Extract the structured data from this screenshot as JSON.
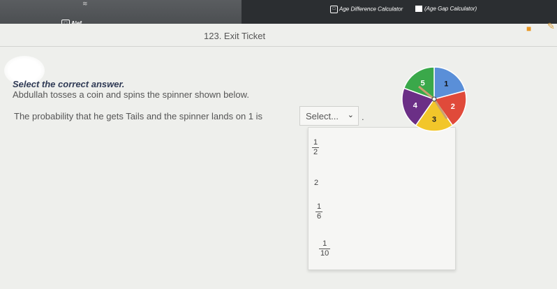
{
  "browser": {
    "brand_label": "Alef",
    "links": [
      {
        "label": "Age Difference Calculator"
      },
      {
        "label": "(Age Gap Calculator)"
      }
    ]
  },
  "header": {
    "title": "123. Exit Ticket"
  },
  "question": {
    "instruction": "Select the correct answer.",
    "stem": "Abdullah tosses a coin and spins the spinner shown below.",
    "prompt": "The probability that he gets Tails and the spinner lands on 1 is",
    "end_punct": ".",
    "select": {
      "placeholder": "Select...",
      "options": [
        {
          "numerator": "1",
          "denominator": "2"
        },
        {
          "value": "2"
        },
        {
          "numerator": "1",
          "denominator": "6"
        },
        {
          "numerator": "1",
          "denominator": "10"
        }
      ]
    }
  },
  "spinner": {
    "sections": [
      {
        "label": "1",
        "color": "#5a8fd8"
      },
      {
        "label": "2",
        "color": "#e04a3a"
      },
      {
        "label": "3",
        "color": "#f2c62a"
      },
      {
        "label": "4",
        "color": "#6b2f86"
      },
      {
        "label": "5",
        "color": "#3aa84a"
      }
    ],
    "pointer_color": "#c9a070"
  },
  "colors": {
    "instruction": "#2f3a55",
    "accent": "#e89520"
  },
  "icons": [
    "close-box-icon",
    "orange-square-icon",
    "pencil-icon",
    "chevron-down-icon"
  ]
}
